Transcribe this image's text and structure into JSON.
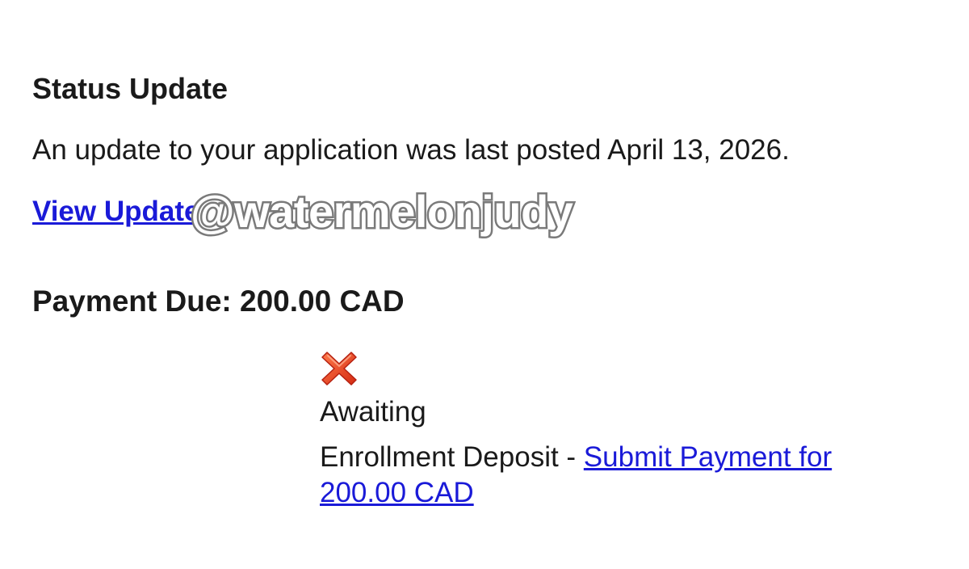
{
  "status": {
    "title": "Status Update",
    "message": "An update to your application was last posted April 13, 2026.",
    "view_link": "View Update"
  },
  "watermark": "@watermelonjudy",
  "payment": {
    "title": "Payment Due: 200.00 CAD",
    "status_icon": "red-x-icon",
    "status_label": "Awaiting",
    "item_label": "Enrollment Deposit - ",
    "submit_link": "Submit Payment for 200.00 CAD"
  },
  "colors": {
    "link": "#1a1ad8",
    "icon_red": "#e0391a"
  }
}
